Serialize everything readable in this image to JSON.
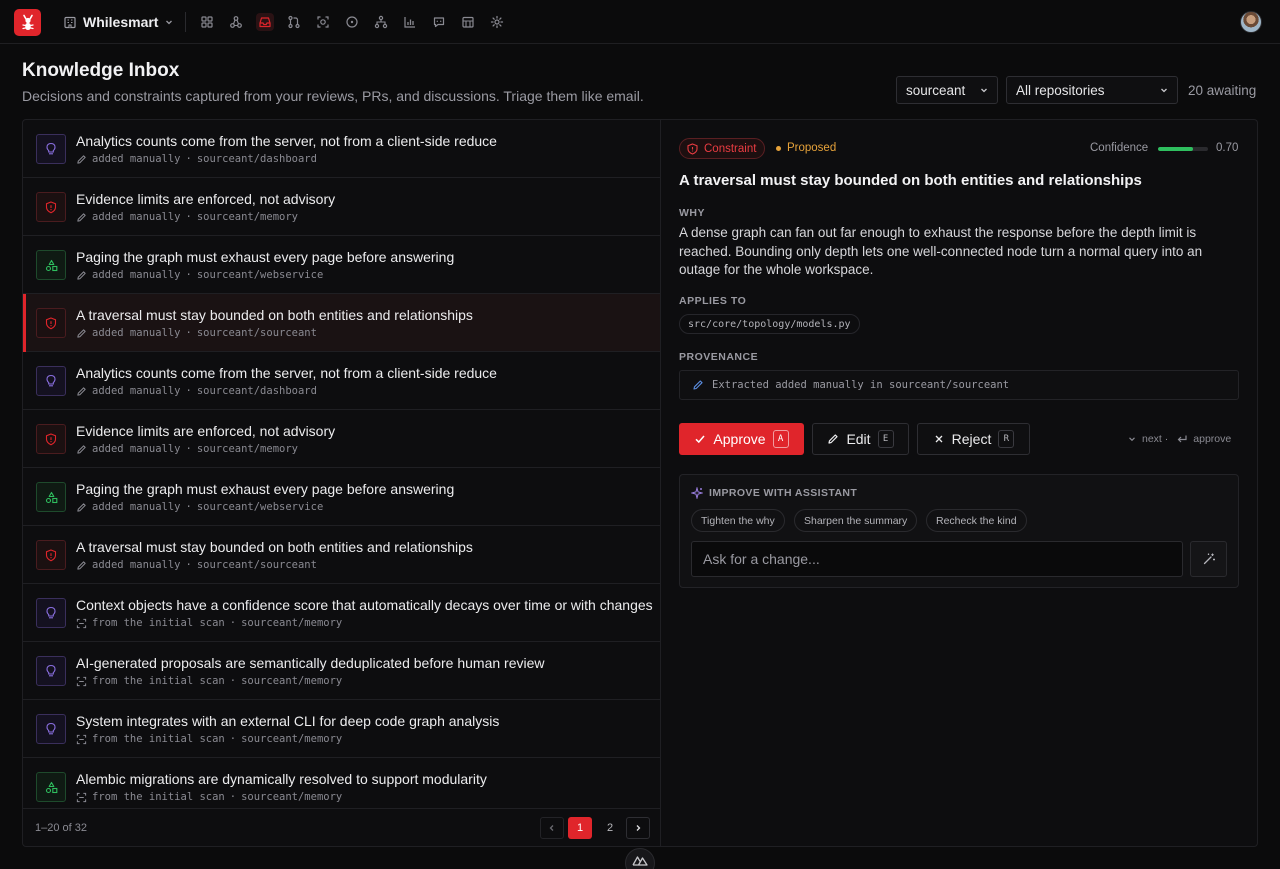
{
  "app": {
    "workspace": "Whilesmart",
    "nav_icons": [
      "dashboard-icon",
      "graph-icon",
      "inbox-icon",
      "pull-request-icon",
      "scan-icon",
      "issues-icon",
      "hierarchy-icon",
      "analytics-icon",
      "chat-icon",
      "repositories-icon",
      "settings-icon"
    ],
    "active_nav": "inbox-icon",
    "accent_color": "#e0252b"
  },
  "header": {
    "title": "Knowledge Inbox",
    "subtitle": "Decisions and constraints captured from your reviews, PRs, and discussions. Triage them like email.",
    "org_select": "sourceant",
    "repo_select": "All repositories",
    "awaiting": "20 awaiting"
  },
  "list": {
    "items": [
      {
        "kind": "idea",
        "title": "Analytics counts come from the server, not from a client-side reduce",
        "source_icon": "pencil-icon",
        "source": "added manually",
        "repo": "sourceant/dashboard",
        "selected": false
      },
      {
        "kind": "constraint",
        "title": "Evidence limits are enforced, not advisory",
        "source_icon": "pencil-icon",
        "source": "added manually",
        "repo": "sourceant/memory",
        "selected": false
      },
      {
        "kind": "pattern",
        "title": "Paging the graph must exhaust every page before answering",
        "source_icon": "pencil-icon",
        "source": "added manually",
        "repo": "sourceant/webservice",
        "selected": false
      },
      {
        "kind": "constraint",
        "title": "A traversal must stay bounded on both entities and relationships",
        "source_icon": "pencil-icon",
        "source": "added manually",
        "repo": "sourceant/sourceant",
        "selected": true
      },
      {
        "kind": "idea",
        "title": "Analytics counts come from the server, not from a client-side reduce",
        "source_icon": "pencil-icon",
        "source": "added manually",
        "repo": "sourceant/dashboard",
        "selected": false
      },
      {
        "kind": "constraint",
        "title": "Evidence limits are enforced, not advisory",
        "source_icon": "pencil-icon",
        "source": "added manually",
        "repo": "sourceant/memory",
        "selected": false
      },
      {
        "kind": "pattern",
        "title": "Paging the graph must exhaust every page before answering",
        "source_icon": "pencil-icon",
        "source": "added manually",
        "repo": "sourceant/webservice",
        "selected": false
      },
      {
        "kind": "constraint",
        "title": "A traversal must stay bounded on both entities and relationships",
        "source_icon": "pencil-icon",
        "source": "added manually",
        "repo": "sourceant/sourceant",
        "selected": false
      },
      {
        "kind": "idea",
        "title": "Context objects have a confidence score that automatically decays over time or with changes",
        "source_icon": "scan-icon",
        "source": "from the initial scan",
        "repo": "sourceant/memory",
        "selected": false
      },
      {
        "kind": "idea",
        "title": "AI-generated proposals are semantically deduplicated before human review",
        "source_icon": "scan-icon",
        "source": "from the initial scan",
        "repo": "sourceant/memory",
        "selected": false
      },
      {
        "kind": "idea",
        "title": "System integrates with an external CLI for deep code graph analysis",
        "source_icon": "scan-icon",
        "source": "from the initial scan",
        "repo": "sourceant/memory",
        "selected": false
      },
      {
        "kind": "pattern",
        "title": "Alembic migrations are dynamically resolved to support modularity",
        "source_icon": "scan-icon",
        "source": "from the initial scan",
        "repo": "sourceant/memory",
        "selected": false
      }
    ],
    "separator": "·",
    "range": "1–20 of 32",
    "pages": [
      "1",
      "2"
    ],
    "current_page": "1"
  },
  "detail": {
    "kind": "Constraint",
    "status": "Proposed",
    "confidence_label": "Confidence",
    "confidence": 0.7,
    "confidence_text": "0.70",
    "title": "A traversal must stay bounded on both entities and relationships",
    "why_label": "WHY",
    "why": "A dense graph can fan out far enough to exhaust the response before the depth limit is reached. Bounding only depth lets one well-connected node turn a normal query into an outage for the whole workspace.",
    "applies_label": "APPLIES TO",
    "applies_to": "src/core/topology/models.py",
    "provenance_label": "PROVENANCE",
    "provenance": "Extracted added manually in sourceant/sourceant",
    "actions": {
      "approve": "Approve",
      "approve_key": "A",
      "edit": "Edit",
      "edit_key": "E",
      "reject": "Reject",
      "reject_key": "R"
    },
    "hints": {
      "next": "next ·",
      "approve": "approve"
    },
    "assistant": {
      "heading": "IMPROVE WITH ASSISTANT",
      "chips": [
        "Tighten the why",
        "Sharpen the summary",
        "Recheck the kind"
      ],
      "placeholder": "Ask for a change..."
    }
  }
}
